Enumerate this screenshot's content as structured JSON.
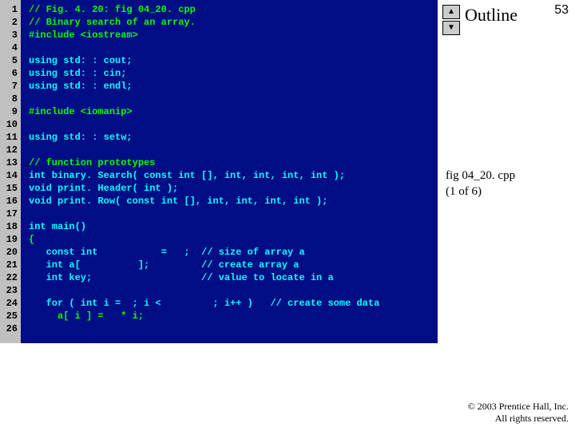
{
  "page_number": "53",
  "outline_label": "Outline",
  "fig_label_line1": "fig 04_20. cpp",
  "fig_label_line2": "(1 of 6)",
  "copyright_line1": "© 2003 Prentice Hall, Inc.",
  "copyright_line2": "All rights reserved.",
  "arrow_up": "▲",
  "arrow_down": "▼",
  "line_numbers": [
    "1",
    "2",
    "3",
    "4",
    "5",
    "6",
    "7",
    "8",
    "9",
    "10",
    "11",
    "12",
    "13",
    "14",
    "15",
    "16",
    "17",
    "18",
    "19",
    "20",
    "21",
    "22",
    "23",
    "24",
    "25",
    "26"
  ],
  "code_lines": [
    {
      "t": "// Fig. 4. 20: fig 04_20. cpp",
      "cls": "c"
    },
    {
      "t": "// Binary search of an array.",
      "cls": "c"
    },
    {
      "t": "#include <iostream>",
      "cls": "pp"
    },
    {
      "t": "",
      "cls": ""
    },
    {
      "t": "using std: : cout;",
      "cls": "kw"
    },
    {
      "t": "using std: : cin;",
      "cls": "kw"
    },
    {
      "t": "using std: : endl;",
      "cls": "kw"
    },
    {
      "t": "",
      "cls": ""
    },
    {
      "t": "#include <iomanip>",
      "cls": "pp"
    },
    {
      "t": "",
      "cls": ""
    },
    {
      "t": "using std: : setw;",
      "cls": "kw"
    },
    {
      "t": "",
      "cls": ""
    },
    {
      "t": "// function prototypes",
      "cls": "c"
    },
    {
      "t": "int binary. Search( const int [], int, int, int, int );",
      "cls": "kw"
    },
    {
      "t": "void print. Header( int );",
      "cls": "kw"
    },
    {
      "t": "void print. Row( const int [], int, int, int, int );",
      "cls": "kw"
    },
    {
      "t": "",
      "cls": ""
    },
    {
      "t": "int main()",
      "cls": "kw"
    },
    {
      "t": "{",
      "cls": ""
    },
    {
      "t": "   const int           =   ;  // size of array a",
      "cls": "kw"
    },
    {
      "t": "   int a[          ];         // create array a",
      "cls": "kw"
    },
    {
      "t": "   int key;                   // value to locate in a",
      "cls": "kw"
    },
    {
      "t": "",
      "cls": ""
    },
    {
      "t": "   for ( int i =  ; i <         ; i++ )   // create some data",
      "cls": "kw"
    },
    {
      "t": "     a[ i ] =   * i;",
      "cls": ""
    },
    {
      "t": "",
      "cls": ""
    }
  ]
}
